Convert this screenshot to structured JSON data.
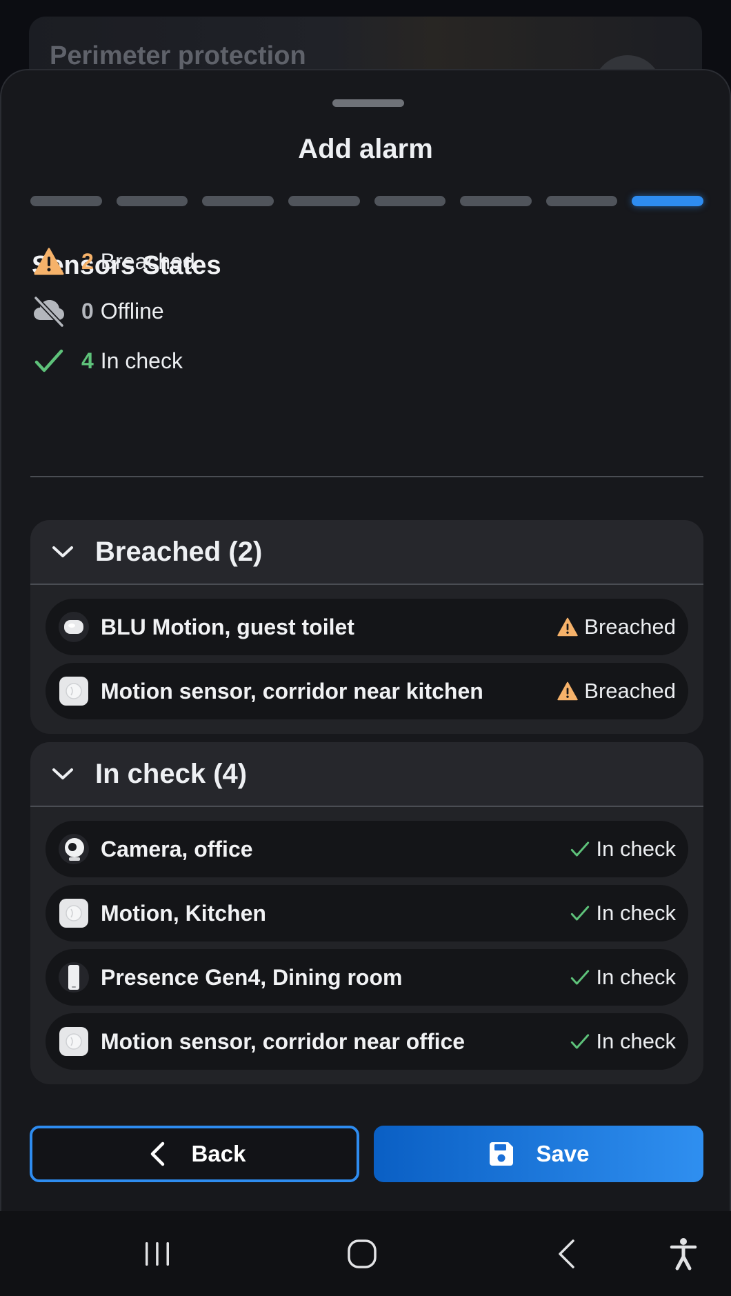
{
  "background": {
    "card_title": "Perimeter protection"
  },
  "sheet": {
    "title": "Add alarm",
    "steps": 8,
    "active_step": 8
  },
  "sensors_states": {
    "title": "Sensors States",
    "breached": {
      "count": "2",
      "label": "Breached",
      "icon": "warning-triangle-icon"
    },
    "offline": {
      "count": "0",
      "label": "Offline",
      "icon": "cloud-off-icon"
    },
    "in_check": {
      "count": "4",
      "label": "In check",
      "icon": "checkmark-icon"
    }
  },
  "groups": [
    {
      "title": "Breached (2)",
      "items": [
        {
          "name": "BLU Motion, guest toilet",
          "state": "Breached",
          "icon": "blu-motion-device-icon"
        },
        {
          "name": "Motion sensor, corridor near kitchen",
          "state": "Breached",
          "icon": "motion-sensor-device-icon"
        }
      ]
    },
    {
      "title": "In check (4)",
      "items": [
        {
          "name": "Camera, office",
          "state": "In check",
          "icon": "camera-device-icon"
        },
        {
          "name": "Motion, Kitchen",
          "state": "In check",
          "icon": "motion-sensor-device-icon"
        },
        {
          "name": "Presence Gen4, Dining room",
          "state": "In check",
          "icon": "presence-sensor-device-icon"
        },
        {
          "name": "Motion sensor, corridor near office",
          "state": "In check",
          "icon": "motion-sensor-device-icon"
        }
      ]
    }
  ],
  "buttons": {
    "back": "Back",
    "save": "Save"
  },
  "colors": {
    "accent": "#2e8cf0",
    "breached": "#f6b26a",
    "in_check": "#5ec27a",
    "offline": "#b4b7bd",
    "sheet_bg": "#17181c"
  }
}
